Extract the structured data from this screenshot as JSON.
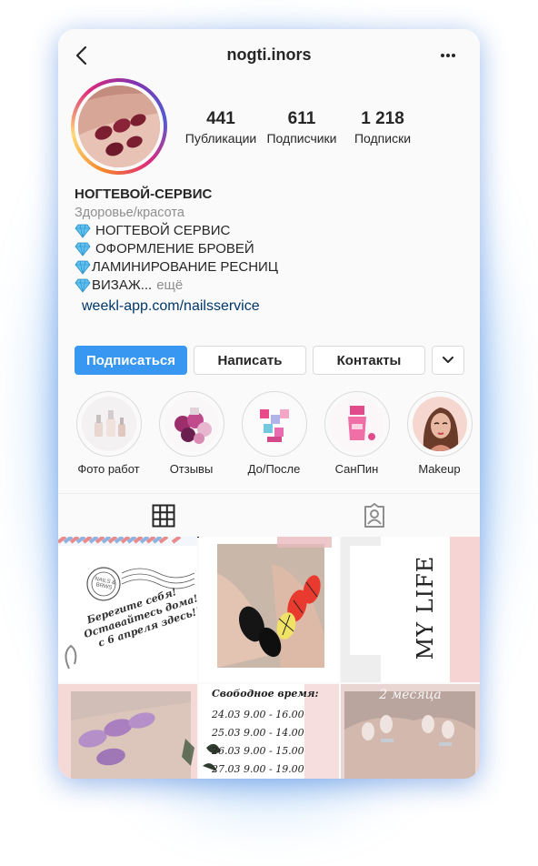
{
  "header": {
    "username": "nogti.inors",
    "back_icon": "chevron-left-icon",
    "more_icon": "more-horizontal-icon"
  },
  "stats": [
    {
      "value": "441",
      "label": "Публикации"
    },
    {
      "value": "611",
      "label": "Подписчики"
    },
    {
      "value": "1 218",
      "label": "Подписки"
    }
  ],
  "bio": {
    "name": "НОГТЕВОЙ-СЕРВИС",
    "category": "Здоровье/красота",
    "lines": [
      "НОГТЕВОЙ СЕРВИС",
      "ОФОРМЛЕНИЕ БРОВЕЙ",
      "ЛАМИНИРОВАНИЕ РЕСНИЦ",
      "ВИЗАЖ..."
    ],
    "more": "ещё",
    "link": "weekl-app.com/nailsservice"
  },
  "buttons": {
    "follow": "Подписаться",
    "message": "Написать",
    "contacts": "Контакты"
  },
  "highlights": [
    {
      "label": "Фото работ"
    },
    {
      "label": "Отзывы"
    },
    {
      "label": "До/После"
    },
    {
      "label": "СанПин"
    },
    {
      "label": "Makeup"
    }
  ],
  "posts": {
    "post1_lines": [
      "Берегите себя!",
      "Оставайтесь дома!",
      "с 6 апреля здесь!!!"
    ],
    "post1_stamp": "NAILS & BRWS",
    "post3_text": "MY LIFE",
    "post5_title": "Свободное время:",
    "post5_lines": [
      "24.03 9.00 - 16.00",
      "25.03 9.00 - 14.00",
      "26.03 9.00 - 15.00",
      "27.03 9.00 - 19.00"
    ],
    "post6_text": "2 месяца"
  },
  "colors": {
    "accent": "#3897f0",
    "link": "#00376b",
    "muted": "#8e8e8e"
  }
}
